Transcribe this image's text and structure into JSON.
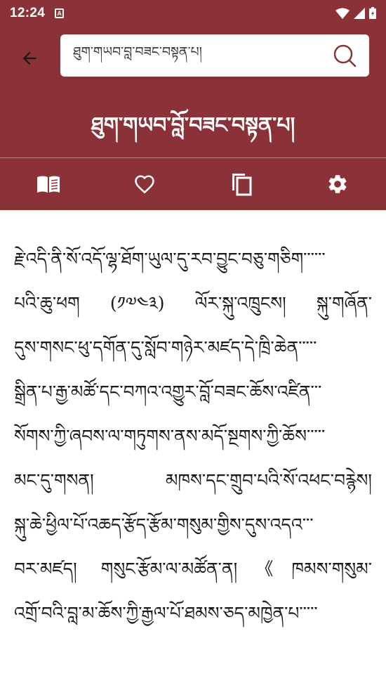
{
  "status": {
    "time": "12:24",
    "notification_glyph": "A"
  },
  "search": {
    "value": "ཐུག་གཡབ་བློ་བཟང་བསྟན་པ།"
  },
  "header": {
    "title": "ཐུག་གཡབ་བློ་བཟང་བསྟན་པ།"
  },
  "toolbar": {
    "icons": [
      "book-icon",
      "heart-icon",
      "copy-icon",
      "gear-icon"
    ]
  },
  "content": {
    "lines": [
      "རྗེ་འདི་ནི་སོ་འདོ་ལྷ་ཐོག་ཡུལ་དུ་རབ་བྱུང་བཅུ་གཅིག་་་་་་",
      "པའི་ཆུ་ཕག (༡༧༤༣) ལོར་སྐུ་འཁྲུངས། སྐུ་གཞོན་",
      "དུས་གསང་ཕུ་དགོན་དུ་སློབ་གཉེར་མཛད་དེ་ཁྲི་ཆེན་་་་་",
      "སྒྲིན་པ་རྒྱ་མཚོ་དང་བཀའ་འགྱུར་བློ་བཟང་ཆོས་འཛིན་་་",
      "སོགས་ཀྱི་ཞབས་ལ་གཏུགས་ནས་མདོ་སྔགས་ཀྱི་ཆོས་་་་་",
      "མང་དུ་གསན། མཁས་དང་གྲུབ་པའི་སོ་འཕང་བརྙེས།",
      "སྐུ་ཆེ་ཕྱིལ་པོ་འཆད་རྩོད་རྩོམ་གསུམ་གྱིས་དུས་འདའ་་་",
      "བར་མཛད། གསུང་རྩོམ་ལ་མཚོན་ན།《ཁམས་གསུམ་",
      "འགྲོ་བའི་བླ་མ་ཆོས་ཀྱི་རྒྱལ་པོ་ཐམས་ཅད་མཁྱེན་པ་་་་་"
    ]
  },
  "colors": {
    "primary": "#8b3138",
    "text": "#1b1b1b"
  }
}
